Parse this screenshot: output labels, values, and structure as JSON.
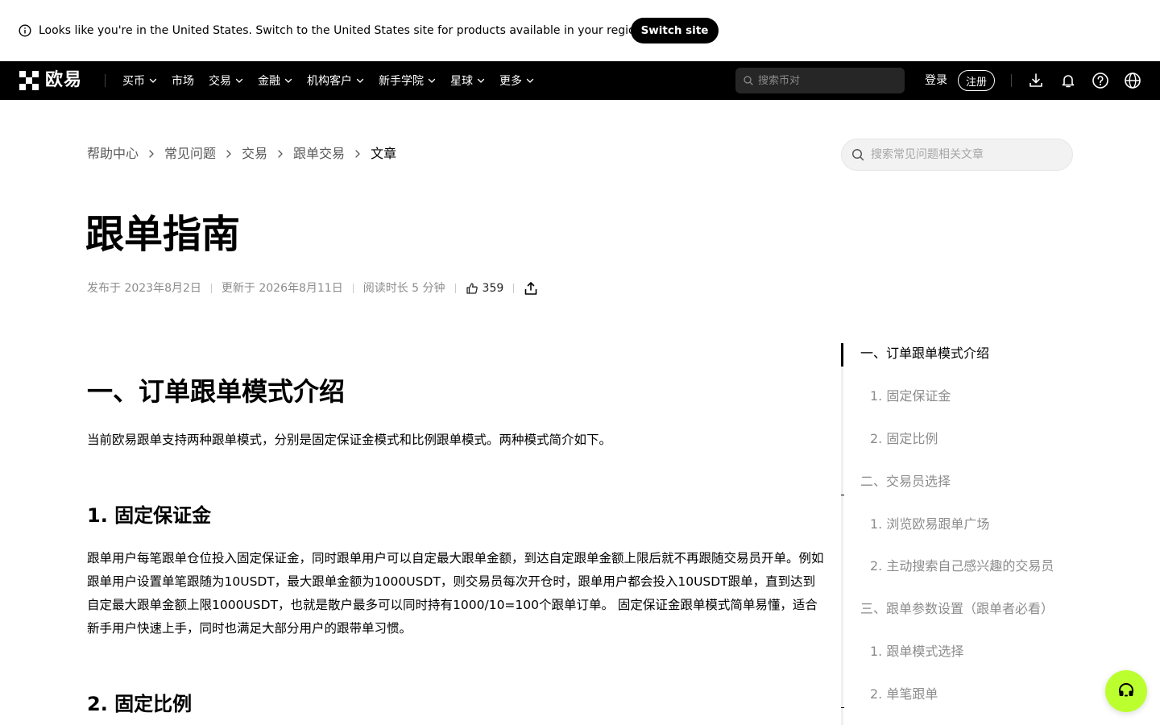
{
  "banner": {
    "message": "Looks like you're in the United States. Switch to the United States site for products available in your region.",
    "switch_label": "Switch site",
    "icon": "info-icon"
  },
  "nav": {
    "brand": "欧易",
    "menu": [
      {
        "label": "买币",
        "dropdown": true
      },
      {
        "label": "市场",
        "dropdown": false
      },
      {
        "label": "交易",
        "dropdown": true
      },
      {
        "label": "金融",
        "dropdown": true
      },
      {
        "label": "机构客户",
        "dropdown": true
      },
      {
        "label": "新手学院",
        "dropdown": true
      },
      {
        "label": "星球",
        "dropdown": true
      },
      {
        "label": "更多",
        "dropdown": true
      }
    ],
    "search_placeholder": "搜索币对",
    "login": "登录",
    "register": "注册",
    "icons": [
      "download-icon",
      "bell-icon",
      "help-icon",
      "globe-icon"
    ]
  },
  "breadcrumb": [
    "帮助中心",
    "常见问题",
    "交易",
    "跟单交易",
    "文章"
  ],
  "faq_search_placeholder": "搜索常见问题相关文章",
  "article": {
    "title": "跟单指南",
    "published": "发布于 2023年8月2日",
    "updated": "更新于 2026年8月11日",
    "read_time": "阅读时长 5 分钟",
    "likes": "359",
    "section1_title": "一、订单跟单模式介绍",
    "section1_intro": "当前欧易跟单支持两种跟单模式，分别是固定保证金模式和比例跟单模式。两种模式简介如下。",
    "sub1_title": "1. 固定保证金",
    "sub1_body": "跟单用户每笔跟单仓位投入固定保证金，同时跟单用户可以自定最大跟单金额，到达自定跟单金额上限后就不再跟随交易员开单。例如跟单用户设置单笔跟随为10USDT，最大跟单金额为1000USDT，则交易员每次开仓时，跟单用户都会投入10USDT跟单，直到达到自定最大跟单金额上限1000USDT，也就是散户最多可以同时持有1000/10=100个跟单订单。 固定保证金跟单模式简单易懂，适合新手用户快速上手，同时也满足大部分用户的跟带单习惯。",
    "sub2_title": "2. 固定比例"
  },
  "toc": [
    {
      "label": "一、订单跟单模式介绍",
      "level": 1,
      "active": true
    },
    {
      "label": "1. 固定保证金",
      "level": 2,
      "active": false
    },
    {
      "label": "2. 固定比例",
      "level": 2,
      "active": false
    },
    {
      "label": "二、交易员选择",
      "level": 1,
      "active": false
    },
    {
      "label": "1. 浏览欧易跟单广场",
      "level": 2,
      "active": false
    },
    {
      "label": "2. 主动搜索自己感兴趣的交易员",
      "level": 2,
      "active": false
    },
    {
      "label": "三、跟单参数设置（跟单者必看）",
      "level": 1,
      "active": false
    },
    {
      "label": "1. 跟单模式选择",
      "level": 2,
      "active": false
    },
    {
      "label": "2. 单笔跟单",
      "level": 2,
      "active": false
    }
  ],
  "colors": {
    "accent": "#bcff2f",
    "nav_bg": "#000000",
    "muted_text": "#8c8c8c"
  }
}
